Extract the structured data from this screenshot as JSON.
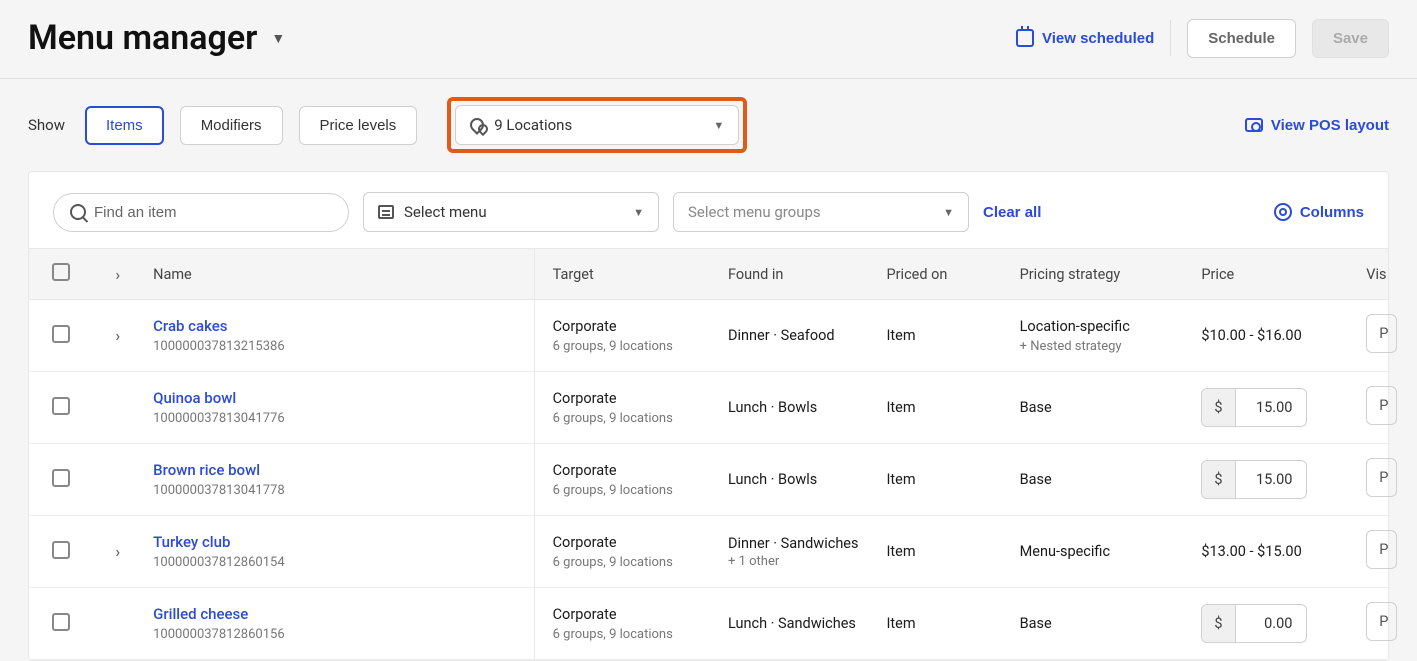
{
  "header": {
    "title": "Menu manager",
    "view_scheduled": "View scheduled",
    "schedule_btn": "Schedule",
    "save_btn": "Save"
  },
  "filters": {
    "show_label": "Show",
    "tabs": [
      "Items",
      "Modifiers",
      "Price levels"
    ],
    "locations_select": "9 Locations",
    "view_pos": "View POS layout"
  },
  "panel": {
    "search_placeholder": "Find an item",
    "select_menu": "Select menu",
    "select_groups": "Select menu groups",
    "clear_all": "Clear all",
    "columns_btn": "Columns"
  },
  "table": {
    "headers": {
      "name": "Name",
      "target": "Target",
      "found": "Found in",
      "priced": "Priced on",
      "strategy": "Pricing strategy",
      "price": "Price",
      "vis": "Vis"
    },
    "rows": [
      {
        "expandable": true,
        "name": "Crab cakes",
        "id": "100000037813215386",
        "target": "Corporate",
        "target_sub": "6 groups, 9 locations",
        "found": "Dinner · Seafood",
        "found_sub": "",
        "priced": "Item",
        "strategy": "Location-specific",
        "strategy_sub": "+ Nested strategy",
        "price_display": "$10.00 - $16.00",
        "price_input": null,
        "vis": "P"
      },
      {
        "expandable": false,
        "name": "Quinoa bowl",
        "id": "100000037813041776",
        "target": "Corporate",
        "target_sub": "6 groups, 9 locations",
        "found": "Lunch · Bowls",
        "found_sub": "",
        "priced": "Item",
        "strategy": "Base",
        "strategy_sub": "",
        "price_display": null,
        "price_input": "15.00",
        "vis": "P"
      },
      {
        "expandable": false,
        "name": "Brown rice bowl",
        "id": "100000037813041778",
        "target": "Corporate",
        "target_sub": "6 groups, 9 locations",
        "found": "Lunch · Bowls",
        "found_sub": "",
        "priced": "Item",
        "strategy": "Base",
        "strategy_sub": "",
        "price_display": null,
        "price_input": "15.00",
        "vis": "P"
      },
      {
        "expandable": true,
        "name": "Turkey club",
        "id": "100000037812860154",
        "target": "Corporate",
        "target_sub": "6 groups, 9 locations",
        "found": "Dinner · Sandwiches",
        "found_sub": "+ 1 other",
        "priced": "Item",
        "strategy": "Menu-specific",
        "strategy_sub": "",
        "price_display": "$13.00 - $15.00",
        "price_input": null,
        "vis": "P"
      },
      {
        "expandable": false,
        "name": "Grilled cheese",
        "id": "100000037812860156",
        "target": "Corporate",
        "target_sub": "6 groups, 9 locations",
        "found": "Lunch · Sandwiches",
        "found_sub": "",
        "priced": "Item",
        "strategy": "Base",
        "strategy_sub": "",
        "price_display": null,
        "price_input": "0.00",
        "vis": "P"
      }
    ]
  }
}
